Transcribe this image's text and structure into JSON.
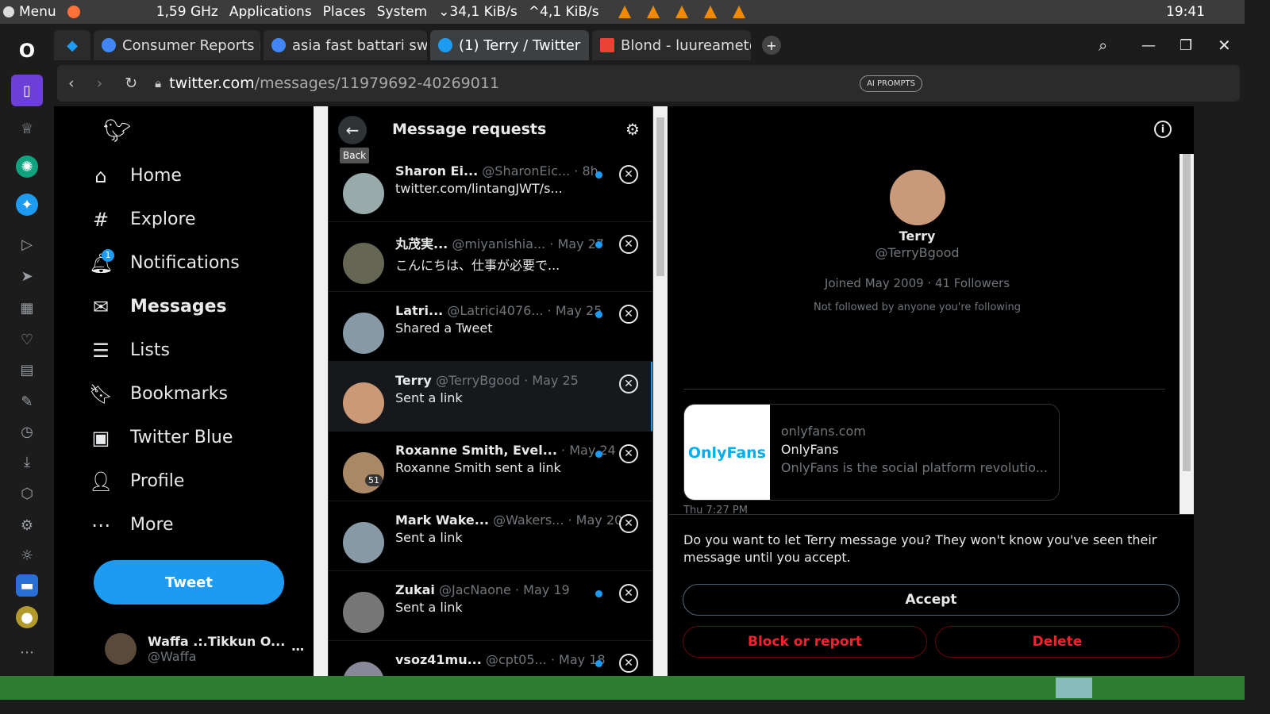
{
  "system": {
    "menu": "Menu",
    "cpu": "1,59 GHz",
    "applications": "Applications",
    "places": "Places",
    "system": "System",
    "down": "34,1 KiB/s",
    "up": "4,1 KiB/s",
    "time": "19:41"
  },
  "tabs": [
    {
      "label": "Consumer Reports re",
      "color": "#4285f4"
    },
    {
      "label": "asia fast battari swap",
      "color": "#4285f4"
    },
    {
      "label": "(1) Terry / Twitter",
      "color": "#1d9bf0"
    },
    {
      "label": "Blond - luureamet@",
      "color": "#ea4335"
    }
  ],
  "url": {
    "domain": "twitter.com",
    "path": "/messages/11979692-40269011",
    "ai": "AI PROMPTS"
  },
  "nav": {
    "items": [
      {
        "label": "Home",
        "icon": "⌂"
      },
      {
        "label": "Explore",
        "icon": "#"
      },
      {
        "label": "Notifications",
        "icon": "🔔︎",
        "badge": "1"
      },
      {
        "label": "Messages",
        "icon": "✉"
      },
      {
        "label": "Lists",
        "icon": "☰"
      },
      {
        "label": "Bookmarks",
        "icon": "🔖︎"
      },
      {
        "label": "Twitter Blue",
        "icon": "▣"
      },
      {
        "label": "Profile",
        "icon": "👤︎"
      },
      {
        "label": "More",
        "icon": "⋯"
      }
    ],
    "tweet": "Tweet",
    "account": {
      "name": "Waffa .:.Tikkun O...",
      "handle": "@Waffa"
    }
  },
  "requests": {
    "title": "Message requests",
    "back_tooltip": "Back",
    "items": [
      {
        "name": "Sharon Ei...",
        "handle": "@SharonEic...",
        "time": "· 8h",
        "text": "twitter.com/lintangJWT/s...",
        "unread": true,
        "color": "#9aa"
      },
      {
        "name": "丸茂実...",
        "handle": "@miyanishia...",
        "time": "· May 27",
        "text": "こんにちは、仕事が必要で...",
        "unread": true,
        "color": "#665"
      },
      {
        "name": "Latri...",
        "handle": "@Latrici4076...",
        "time": "· May 25",
        "text": "Shared a Tweet",
        "unread": true,
        "color": "#8899a6"
      },
      {
        "name": "Terry",
        "handle": "@TerryBgood",
        "time": "· May 25",
        "text": "Sent a link",
        "unread": false,
        "color": "#c97",
        "selected": true
      },
      {
        "name": "Roxanne Smith, Evel...",
        "handle": "",
        "time": "· May 24",
        "text": "Roxanne Smith sent a link",
        "unread": true,
        "color": "#a86",
        "badge": "51"
      },
      {
        "name": "Mark Wake...",
        "handle": "@Wakers...",
        "time": "· May 20",
        "text": "Sent a link",
        "unread": false,
        "color": "#8899a6"
      },
      {
        "name": "Zukai",
        "handle": "@JacNaone",
        "time": "· May 19",
        "text": "Sent a link",
        "unread": true,
        "color": "#777"
      },
      {
        "name": "vsoz41mu...",
        "handle": "@cpt05...",
        "time": "· May 18",
        "text": "",
        "unread": true,
        "color": "#889"
      }
    ]
  },
  "conversation": {
    "name": "Terry",
    "handle": "@TerryBgood",
    "joined": "Joined May 2009 · 41 Followers",
    "followed": "Not followed by anyone you're following",
    "card": {
      "logo": "OnlyFans",
      "domain": "onlyfans.com",
      "title": "OnlyFans",
      "desc": "OnlyFans is the social platform revolutio..."
    },
    "timestamp": "Thu 7:27 PM",
    "prompt": "Do you want to let Terry message you? They won't know you've seen their message until you accept.",
    "accept": "Accept",
    "block": "Block or report",
    "delete": "Delete"
  }
}
